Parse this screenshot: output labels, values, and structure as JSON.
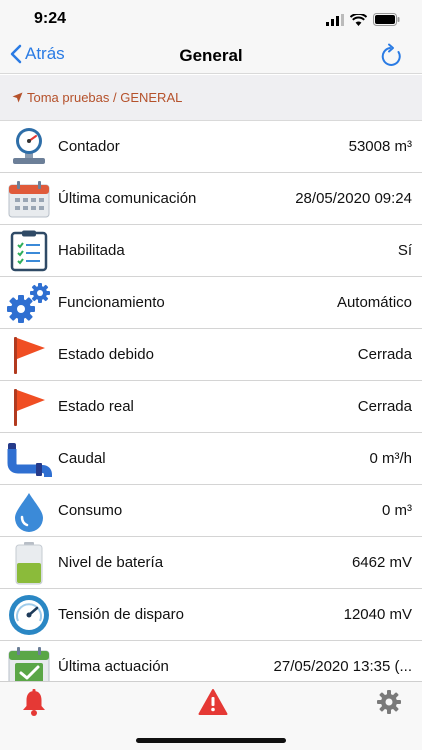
{
  "status": {
    "time": "9:24"
  },
  "nav": {
    "back_label": "Atrás",
    "title": "General"
  },
  "breadcrumb": {
    "text": "Toma pruebas / GENERAL"
  },
  "colors": {
    "accent": "#2a7be4",
    "breadcrumb": "#b5512b",
    "alert": "#e53935"
  },
  "rows": [
    {
      "icon": "pressure-gauge-icon",
      "label": "Contador",
      "value": "53008 m³"
    },
    {
      "icon": "calendar-icon",
      "label": "Última comunicación",
      "value": "28/05/2020 09:24"
    },
    {
      "icon": "clipboard-checklist-icon",
      "label": "Habilitada",
      "value": "Sí"
    },
    {
      "icon": "gears-icon",
      "label": "Funcionamiento",
      "value": "Automático"
    },
    {
      "icon": "red-flag-icon",
      "label": "Estado debido",
      "value": "Cerrada"
    },
    {
      "icon": "red-flag-icon",
      "label": "Estado real",
      "value": "Cerrada"
    },
    {
      "icon": "pipe-icon",
      "label": "Caudal",
      "value": "0 m³/h"
    },
    {
      "icon": "water-drop-icon",
      "label": "Consumo",
      "value": "0 m³"
    },
    {
      "icon": "battery-icon",
      "label": "Nivel de batería",
      "value": "6462 mV"
    },
    {
      "icon": "speedometer-icon",
      "label": "Tensión de disparo",
      "value": "12040 mV"
    },
    {
      "icon": "calendar-check-icon",
      "label": "Última actuación",
      "value": "27/05/2020 13:35 (..."
    }
  ],
  "tabs": [
    {
      "icon": "bell-icon"
    },
    {
      "icon": "warning-triangle-icon"
    },
    {
      "icon": "gear-icon"
    }
  ]
}
